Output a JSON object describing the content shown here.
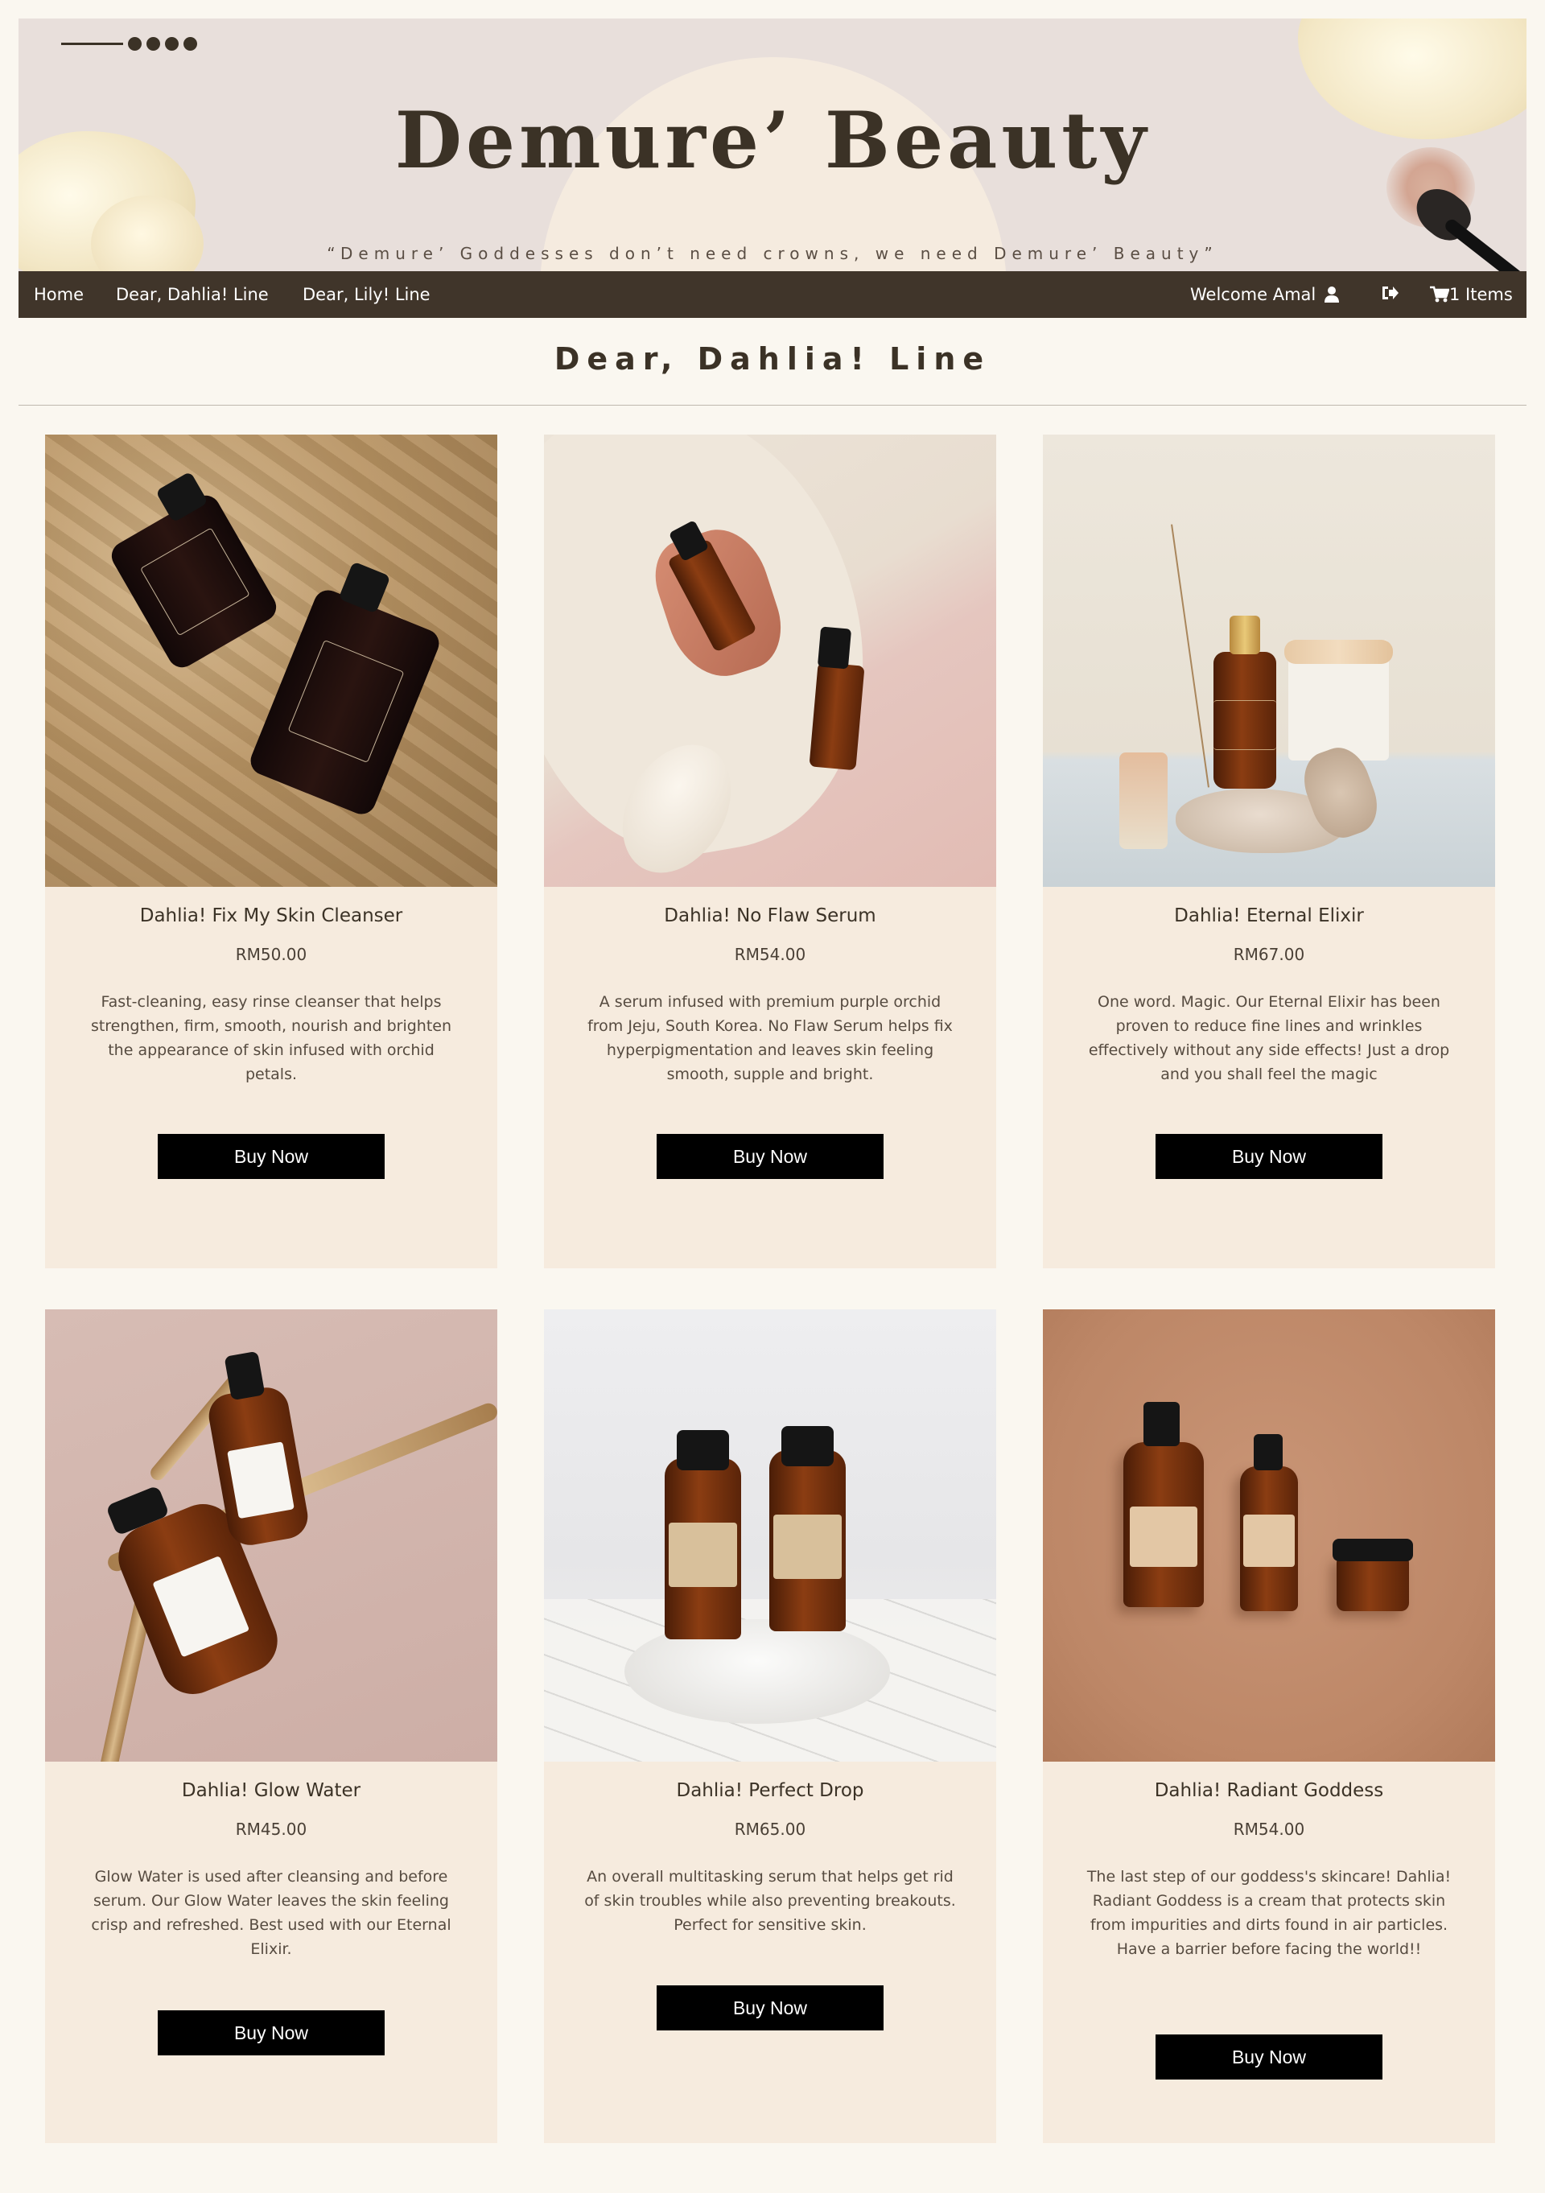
{
  "header": {
    "brand": "Demure’ Beauty",
    "tagline": "“Demure’ Goddesses don’t need crowns, we need Demure’ Beauty”",
    "menu_icon": "menu-dots-icon"
  },
  "nav": {
    "links": [
      "Home",
      "Dear, Dahlia! Line",
      "Dear, Lily! Line"
    ],
    "welcome": "Welcome Amal",
    "cart": "1 Items",
    "icons": {
      "user": "user-icon",
      "logout": "logout-icon",
      "cart": "cart-icon"
    }
  },
  "section": {
    "title": "Dear, Dahlia! Line"
  },
  "products": [
    {
      "name": "Dahlia! Fix My Skin Cleanser",
      "price": "RM50.00",
      "description": "Fast-cleaning, easy rinse cleanser that helps strengthen, firm, smooth, nourish and brighten the appearance of skin infused with orchid petals.",
      "button": "Buy Now"
    },
    {
      "name": "Dahlia! No Flaw Serum",
      "price": "RM54.00",
      "description": "A serum infused with premium purple orchid from Jeju, South Korea. No Flaw Serum helps fix hyperpigmentation and leaves skin feeling smooth, supple and bright.",
      "button": "Buy Now"
    },
    {
      "name": "Dahlia! Eternal Elixir",
      "price": "RM67.00",
      "description": "One word. Magic. Our Eternal Elixir has been proven to reduce fine lines and wrinkles effectively without any side effects! Just a drop and you shall feel the magic",
      "button": "Buy Now"
    },
    {
      "name": "Dahlia! Glow Water",
      "price": "RM45.00",
      "description": "Glow Water is used after cleansing and before serum. Our Glow Water leaves the skin feeling crisp and refreshed. Best used with our Eternal Elixir.",
      "button": "Buy Now"
    },
    {
      "name": "Dahlia! Perfect Drop",
      "price": "RM65.00",
      "description": "An overall multitasking serum that helps get rid of skin troubles while also preventing breakouts. Perfect for sensitive skin.",
      "button": "Buy Now"
    },
    {
      "name": "Dahlia! Radiant Goddess",
      "price": "RM54.00",
      "description": "The last step of our goddess's skincare! Dahlia! Radiant Goddess is a cream that protects skin from impurities and dirts found in air particles. Have a barrier before facing the world!!",
      "button": "Buy Now"
    }
  ],
  "colors": {
    "page_bg": "#faf7f0",
    "header_bg": "#e8dfdb",
    "nav_bg": "#40352a",
    "card_bg": "#f6ebde",
    "button_bg": "#000000"
  }
}
